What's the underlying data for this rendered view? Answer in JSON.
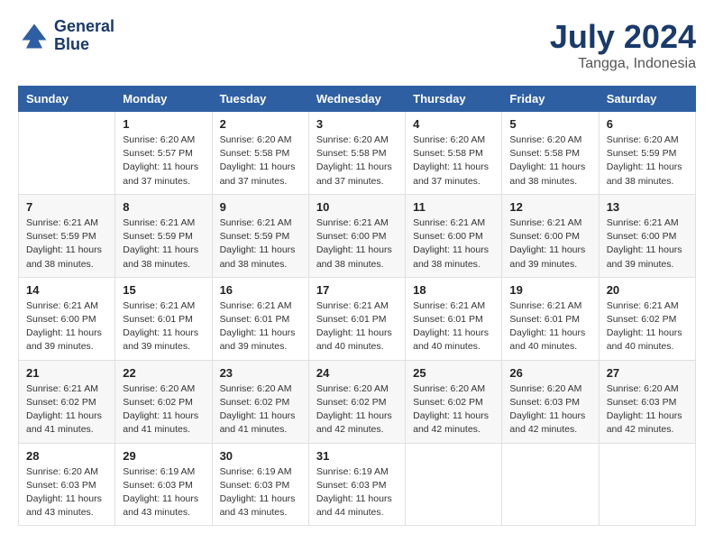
{
  "header": {
    "logo_line1": "General",
    "logo_line2": "Blue",
    "month": "July 2024",
    "location": "Tangga, Indonesia"
  },
  "days_of_week": [
    "Sunday",
    "Monday",
    "Tuesday",
    "Wednesday",
    "Thursday",
    "Friday",
    "Saturday"
  ],
  "weeks": [
    [
      {
        "day": "",
        "info": ""
      },
      {
        "day": "1",
        "info": "Sunrise: 6:20 AM\nSunset: 5:57 PM\nDaylight: 11 hours and 37 minutes."
      },
      {
        "day": "2",
        "info": "Sunrise: 6:20 AM\nSunset: 5:58 PM\nDaylight: 11 hours and 37 minutes."
      },
      {
        "day": "3",
        "info": "Sunrise: 6:20 AM\nSunset: 5:58 PM\nDaylight: 11 hours and 37 minutes."
      },
      {
        "day": "4",
        "info": "Sunrise: 6:20 AM\nSunset: 5:58 PM\nDaylight: 11 hours and 37 minutes."
      },
      {
        "day": "5",
        "info": "Sunrise: 6:20 AM\nSunset: 5:58 PM\nDaylight: 11 hours and 38 minutes."
      },
      {
        "day": "6",
        "info": "Sunrise: 6:20 AM\nSunset: 5:59 PM\nDaylight: 11 hours and 38 minutes."
      }
    ],
    [
      {
        "day": "7",
        "info": "Sunrise: 6:21 AM\nSunset: 5:59 PM\nDaylight: 11 hours and 38 minutes."
      },
      {
        "day": "8",
        "info": "Sunrise: 6:21 AM\nSunset: 5:59 PM\nDaylight: 11 hours and 38 minutes."
      },
      {
        "day": "9",
        "info": "Sunrise: 6:21 AM\nSunset: 5:59 PM\nDaylight: 11 hours and 38 minutes."
      },
      {
        "day": "10",
        "info": "Sunrise: 6:21 AM\nSunset: 6:00 PM\nDaylight: 11 hours and 38 minutes."
      },
      {
        "day": "11",
        "info": "Sunrise: 6:21 AM\nSunset: 6:00 PM\nDaylight: 11 hours and 38 minutes."
      },
      {
        "day": "12",
        "info": "Sunrise: 6:21 AM\nSunset: 6:00 PM\nDaylight: 11 hours and 39 minutes."
      },
      {
        "day": "13",
        "info": "Sunrise: 6:21 AM\nSunset: 6:00 PM\nDaylight: 11 hours and 39 minutes."
      }
    ],
    [
      {
        "day": "14",
        "info": "Sunrise: 6:21 AM\nSunset: 6:00 PM\nDaylight: 11 hours and 39 minutes."
      },
      {
        "day": "15",
        "info": "Sunrise: 6:21 AM\nSunset: 6:01 PM\nDaylight: 11 hours and 39 minutes."
      },
      {
        "day": "16",
        "info": "Sunrise: 6:21 AM\nSunset: 6:01 PM\nDaylight: 11 hours and 39 minutes."
      },
      {
        "day": "17",
        "info": "Sunrise: 6:21 AM\nSunset: 6:01 PM\nDaylight: 11 hours and 40 minutes."
      },
      {
        "day": "18",
        "info": "Sunrise: 6:21 AM\nSunset: 6:01 PM\nDaylight: 11 hours and 40 minutes."
      },
      {
        "day": "19",
        "info": "Sunrise: 6:21 AM\nSunset: 6:01 PM\nDaylight: 11 hours and 40 minutes."
      },
      {
        "day": "20",
        "info": "Sunrise: 6:21 AM\nSunset: 6:02 PM\nDaylight: 11 hours and 40 minutes."
      }
    ],
    [
      {
        "day": "21",
        "info": "Sunrise: 6:21 AM\nSunset: 6:02 PM\nDaylight: 11 hours and 41 minutes."
      },
      {
        "day": "22",
        "info": "Sunrise: 6:20 AM\nSunset: 6:02 PM\nDaylight: 11 hours and 41 minutes."
      },
      {
        "day": "23",
        "info": "Sunrise: 6:20 AM\nSunset: 6:02 PM\nDaylight: 11 hours and 41 minutes."
      },
      {
        "day": "24",
        "info": "Sunrise: 6:20 AM\nSunset: 6:02 PM\nDaylight: 11 hours and 42 minutes."
      },
      {
        "day": "25",
        "info": "Sunrise: 6:20 AM\nSunset: 6:02 PM\nDaylight: 11 hours and 42 minutes."
      },
      {
        "day": "26",
        "info": "Sunrise: 6:20 AM\nSunset: 6:03 PM\nDaylight: 11 hours and 42 minutes."
      },
      {
        "day": "27",
        "info": "Sunrise: 6:20 AM\nSunset: 6:03 PM\nDaylight: 11 hours and 42 minutes."
      }
    ],
    [
      {
        "day": "28",
        "info": "Sunrise: 6:20 AM\nSunset: 6:03 PM\nDaylight: 11 hours and 43 minutes."
      },
      {
        "day": "29",
        "info": "Sunrise: 6:19 AM\nSunset: 6:03 PM\nDaylight: 11 hours and 43 minutes."
      },
      {
        "day": "30",
        "info": "Sunrise: 6:19 AM\nSunset: 6:03 PM\nDaylight: 11 hours and 43 minutes."
      },
      {
        "day": "31",
        "info": "Sunrise: 6:19 AM\nSunset: 6:03 PM\nDaylight: 11 hours and 44 minutes."
      },
      {
        "day": "",
        "info": ""
      },
      {
        "day": "",
        "info": ""
      },
      {
        "day": "",
        "info": ""
      }
    ]
  ]
}
